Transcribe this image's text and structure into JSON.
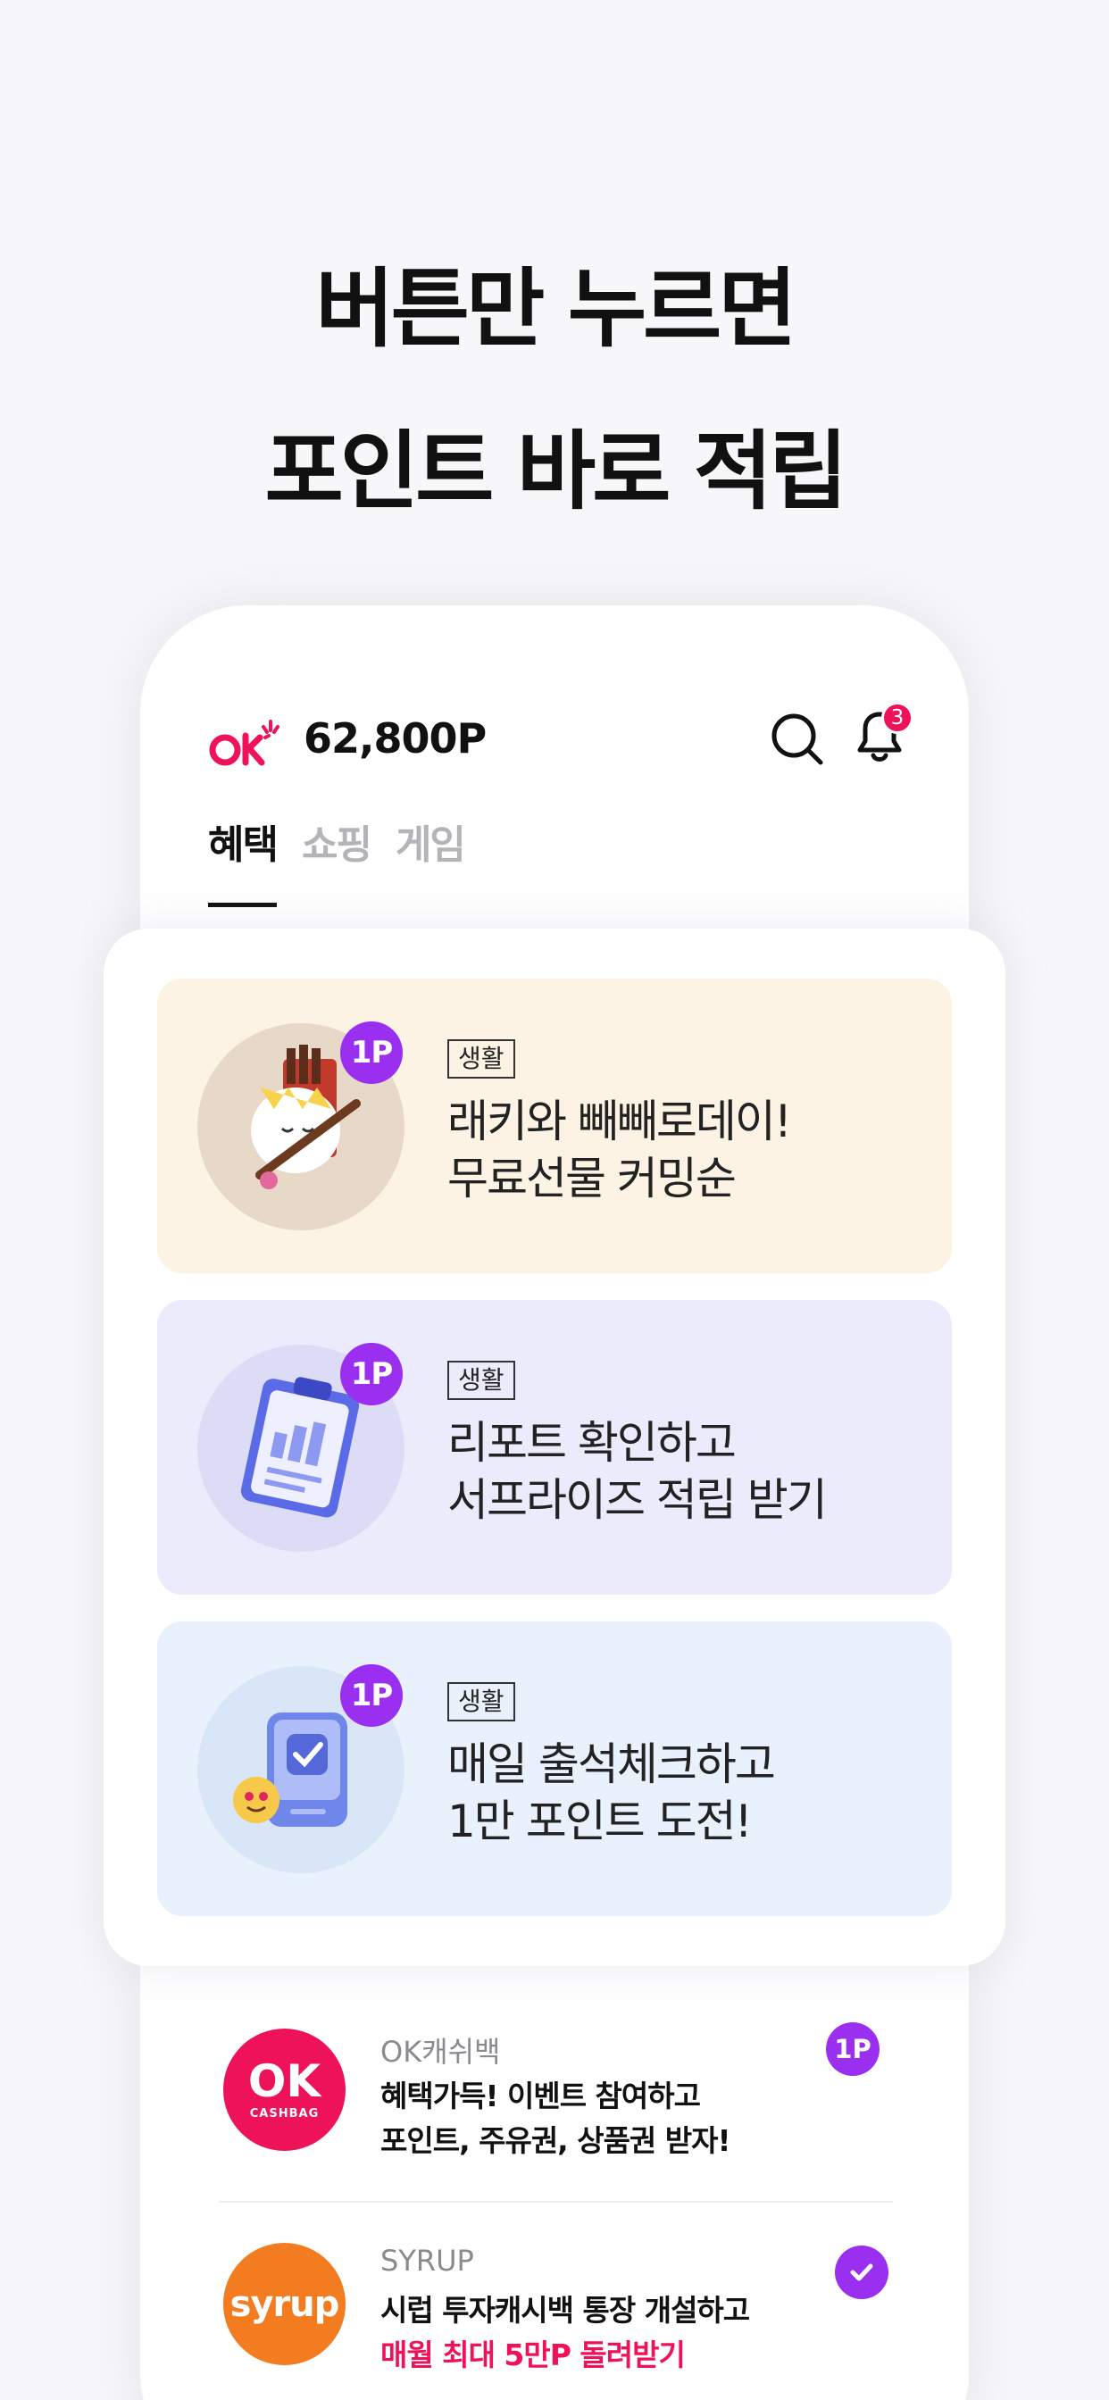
{
  "headline": {
    "line1": "버튼만 누르면",
    "line2": "포인트 바로 적립"
  },
  "header": {
    "logo_text": "OK",
    "points": "62,800P",
    "notification_count": "3"
  },
  "tabs": [
    {
      "label": "혜택",
      "active": true
    },
    {
      "label": "쇼핑",
      "active": false
    },
    {
      "label": "게임",
      "active": false
    }
  ],
  "benefits": [
    {
      "badge": "1P",
      "category": "생활",
      "title_line1": "래키와 빼빼로데이!",
      "title_line2": "무료선물 커밍순",
      "icon": "lucky-cat-pepero-icon",
      "bg": "#fdf3e4"
    },
    {
      "badge": "1P",
      "category": "생활",
      "title_line1": "리포트 확인하고",
      "title_line2": "서프라이즈 적립 받기",
      "icon": "clipboard-report-icon",
      "bg": "#ebebfc"
    },
    {
      "badge": "1P",
      "category": "생활",
      "title_line1": "매일 출석체크하고",
      "title_line2": "1만 포인트 도전!",
      "icon": "attendance-check-icon",
      "bg": "#e9f1fd"
    }
  ],
  "list": [
    {
      "logo_text": "OK",
      "logo_sub": "CASHBAG",
      "brand": "OK캐쉬백",
      "line1": "혜택가득! 이벤트 참여하고",
      "line2": "포인트, 주유권, 상품권 받자!",
      "badge": "1P",
      "logo_color": "#ee1259"
    },
    {
      "logo_text": "syrup",
      "brand": "SYRUP",
      "line1": "시럽 투자캐시백 통장 개설하고",
      "line2": "매월 최대 5만P 돌려받기",
      "logo_color": "#f47c20",
      "status": "checked"
    }
  ],
  "colors": {
    "accent_pink": "#ee1259",
    "badge_purple": "#9b2ff0",
    "syrup_orange": "#f47c20"
  }
}
